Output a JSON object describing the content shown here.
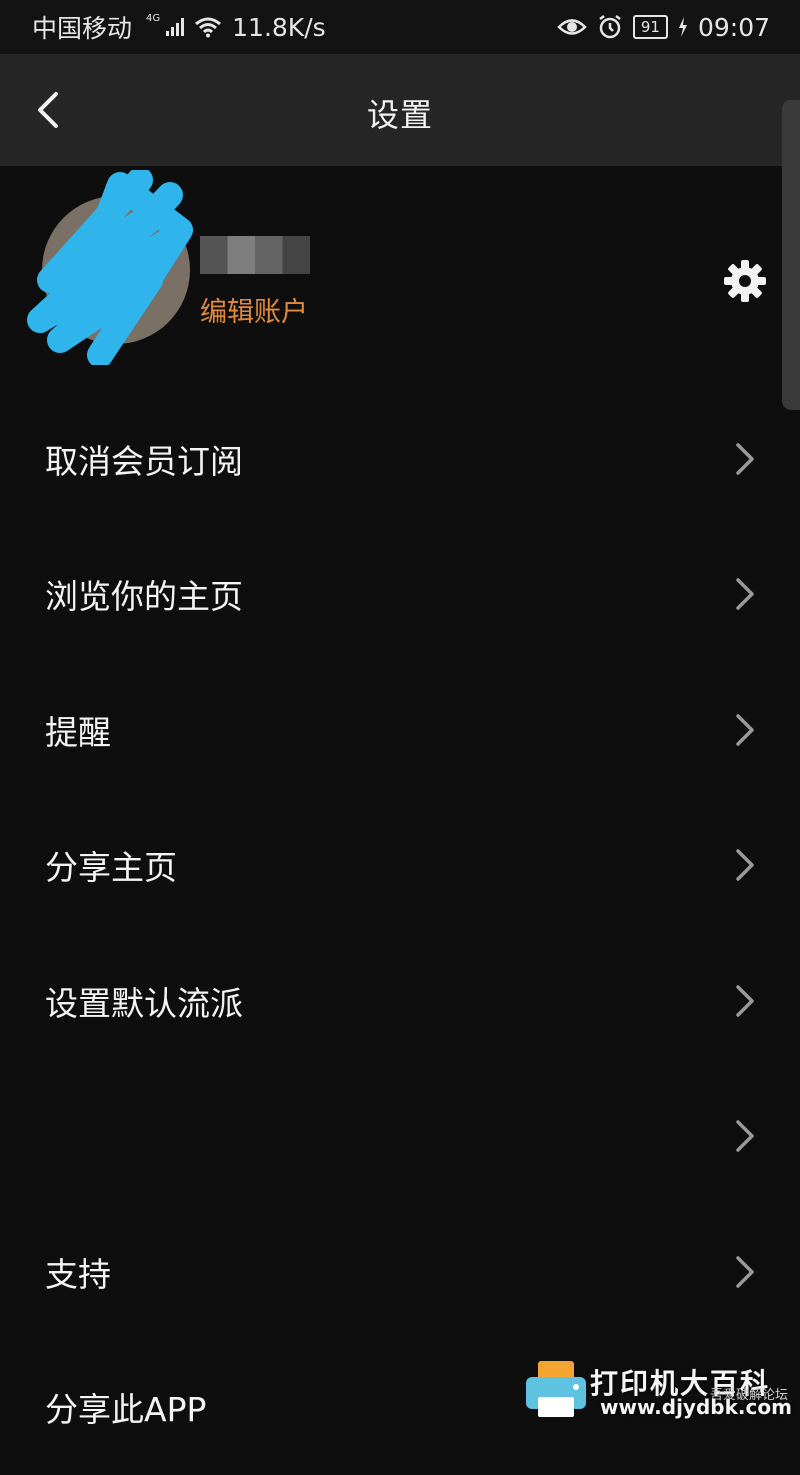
{
  "status_bar": {
    "carrier": "中国移动",
    "network_gen": "4G",
    "net_speed": "11.8K/s",
    "battery": "91",
    "time": "09:07"
  },
  "header": {
    "title": "设置",
    "back_icon": "chevron-left-icon"
  },
  "profile": {
    "edit_account_label": "编辑账户",
    "settings_icon": "gear-icon"
  },
  "menu": {
    "items": [
      {
        "label": "取消会员订阅"
      },
      {
        "label": "浏览你的主页"
      },
      {
        "label": "提醒"
      },
      {
        "label": "分享主页"
      },
      {
        "label": "设置默认流派"
      },
      {
        "label": ""
      },
      {
        "label": "支持"
      },
      {
        "label": "分享此APP"
      }
    ]
  },
  "watermark": {
    "title": "打印机大百科",
    "sub": "吾爱破解论坛",
    "url": "www.djydbk.com"
  },
  "colors": {
    "background": "#0e0e0e",
    "app_bar": "#262626",
    "accent_orange": "#e28a3c",
    "scribble_blue": "#2fb5ec"
  }
}
